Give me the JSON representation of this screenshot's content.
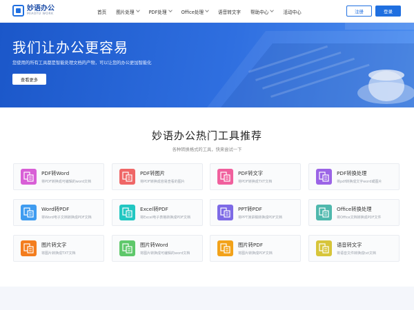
{
  "header": {
    "logo_cn": "妙语办公",
    "logo_en": "MIAOYU WORK",
    "nav": [
      {
        "label": "首页",
        "dropdown": false
      },
      {
        "label": "图片处理",
        "dropdown": true
      },
      {
        "label": "PDF处理",
        "dropdown": true
      },
      {
        "label": "Office处理",
        "dropdown": true
      },
      {
        "label": "语音转文字",
        "dropdown": false
      },
      {
        "label": "帮助中心",
        "dropdown": true
      },
      {
        "label": "活动中心",
        "dropdown": false
      }
    ],
    "register_label": "注册",
    "login_label": "登录"
  },
  "banner": {
    "title": "我们让办公更容易",
    "subtitle": "您使用的所有工具都是智能处理文档的产物，可以让您的办公更加智能化",
    "button_label": "查看更多"
  },
  "tools": {
    "title": "妙语办公热门工具推荐",
    "subtitle": "各种转换格式的工具，快来尝试一下",
    "items": [
      {
        "title": "PDF转Word",
        "desc": "将PDF转换成可编辑的word文档",
        "icon": "pdf-to-word-icon",
        "color": "#d85fd6"
      },
      {
        "title": "PDF转图片",
        "desc": "将PDF转换成容易查看的图片",
        "icon": "pdf-to-image-icon",
        "color": "#ef6767"
      },
      {
        "title": "PDF转文字",
        "desc": "将PDF转换成TXT文档",
        "icon": "pdf-to-text-icon",
        "color": "#f0609d"
      },
      {
        "title": "PDF转换处理",
        "desc": "将pdf转换成文字word或图片",
        "icon": "pdf-convert-icon",
        "color": "#9b64e6"
      },
      {
        "title": "Word转PDF",
        "desc": "将Word电子文档转换成PDF文档",
        "icon": "word-to-pdf-icon",
        "color": "#3f9cf0"
      },
      {
        "title": "Excel转PDF",
        "desc": "将Excel电子表格转换成PDF文档",
        "icon": "excel-to-pdf-icon",
        "color": "#22c7c2"
      },
      {
        "title": "PPT转PDF",
        "desc": "将PPT演讲稿转换成PDF文档",
        "icon": "ppt-to-pdf-icon",
        "color": "#7d6ae6"
      },
      {
        "title": "Office转换处理",
        "desc": "将Office文档转换成PDF文件",
        "icon": "office-convert-icon",
        "color": "#4fb8ad"
      },
      {
        "title": "图片转文字",
        "desc": "将图片转换成TXT文档",
        "icon": "image-to-text-icon",
        "color": "#f37d1e"
      },
      {
        "title": "图片转Word",
        "desc": "将图片转换成可编辑的word文档",
        "icon": "image-to-word-icon",
        "color": "#5fc86b"
      },
      {
        "title": "图片转PDF",
        "desc": "将图片转换成PDF文档",
        "icon": "image-to-pdf-icon",
        "color": "#f2a21a"
      },
      {
        "title": "语音转文字",
        "desc": "将语音文件转换成txt文档",
        "icon": "voice-to-text-icon",
        "color": "#d7c53a"
      }
    ]
  }
}
